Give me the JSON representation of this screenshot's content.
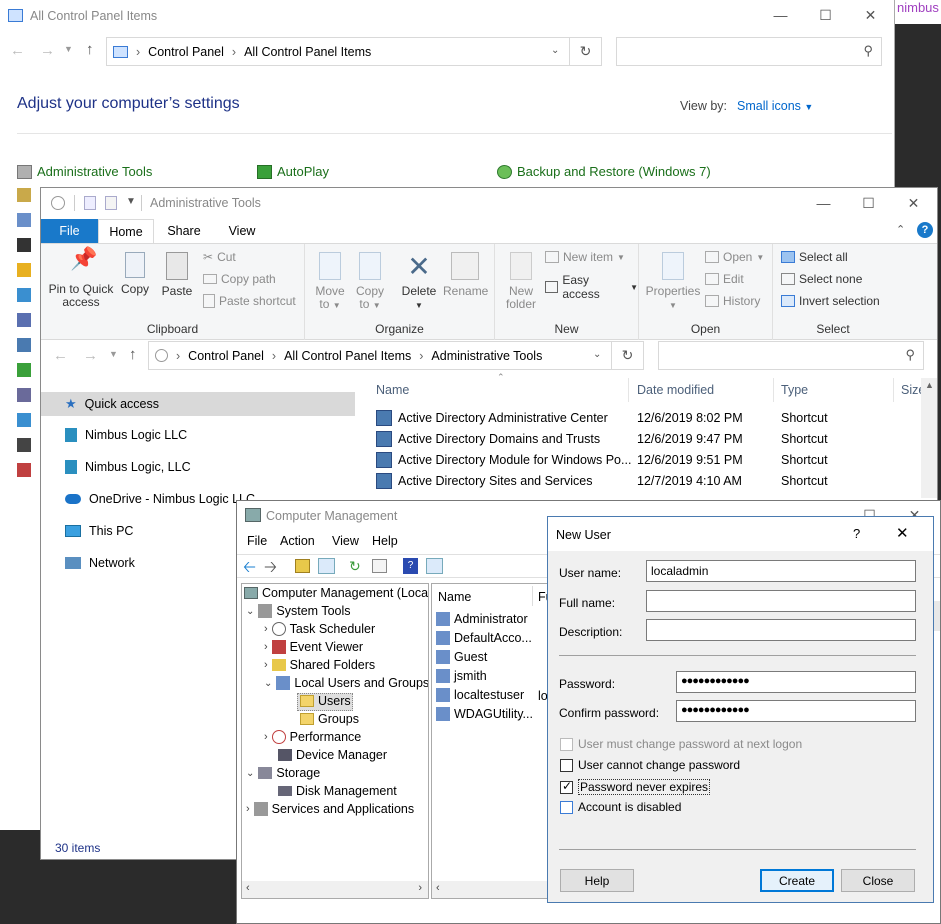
{
  "cp": {
    "title": "All Control Panel Items",
    "breadcrumb": [
      "Control Panel",
      "All Control Panel Items"
    ],
    "heading": "Adjust your computer’s settings",
    "viewby_label": "View by:",
    "viewby_value": "Small icons",
    "items": [
      "Administrative Tools",
      "AutoPlay",
      "Backup and Restore (Windows 7)"
    ],
    "status": "30 items",
    "top_right_text": "nimbus"
  },
  "at": {
    "title": "Administrative Tools",
    "tabs": [
      "File",
      "Home",
      "Share",
      "View"
    ],
    "ribbon": {
      "pin": "Pin to Quick access",
      "copy": "Copy",
      "paste": "Paste",
      "cut": "Cut",
      "copy_path": "Copy path",
      "paste_shortcut": "Paste shortcut",
      "group_clipboard": "Clipboard",
      "move_to": "Move to",
      "copy_to": "Copy to",
      "delete": "Delete",
      "rename": "Rename",
      "group_organize": "Organize",
      "new_folder": "New folder",
      "new_item": "New item",
      "easy_access": "Easy access",
      "group_new": "New",
      "properties": "Properties",
      "open": "Open",
      "edit": "Edit",
      "history": "History",
      "group_open": "Open",
      "select_all": "Select all",
      "select_none": "Select none",
      "invert": "Invert selection",
      "group_select": "Select"
    },
    "breadcrumb": [
      "Control Panel",
      "All Control Panel Items",
      "Administrative Tools"
    ],
    "nav": [
      "Quick access",
      "Nimbus Logic LLC",
      "Nimbus Logic, LLC",
      "OneDrive - Nimbus Logic LLC",
      "This PC",
      "Network"
    ],
    "columns": [
      "Name",
      "Date modified",
      "Type",
      "Size"
    ],
    "files": [
      {
        "name": "Active Directory Administrative Center",
        "date": "12/6/2019 8:02 PM",
        "type": "Shortcut"
      },
      {
        "name": "Active Directory Domains and Trusts",
        "date": "12/6/2019 9:47 PM",
        "type": "Shortcut"
      },
      {
        "name": "Active Directory Module for Windows Po...",
        "date": "12/6/2019 9:51 PM",
        "type": "Shortcut"
      },
      {
        "name": "Active Directory Sites and Services",
        "date": "12/7/2019 4:10 AM",
        "type": "Shortcut"
      }
    ]
  },
  "cm": {
    "title": "Computer Management",
    "menu": [
      "File",
      "Action",
      "View",
      "Help"
    ],
    "tree": [
      "Computer Management (Local",
      "System Tools",
      "Task Scheduler",
      "Event Viewer",
      "Shared Folders",
      "Local Users and Groups",
      "Users",
      "Groups",
      "Performance",
      "Device Manager",
      "Storage",
      "Disk Management",
      "Services and Applications"
    ],
    "col_name": "Name",
    "col_fu": "Fu",
    "users": [
      "Administrator",
      "DefaultAcco...",
      "Guest",
      "jsmith",
      "localtestuser",
      "WDAGUtility..."
    ],
    "lo": "lo"
  },
  "nu": {
    "title": "New User",
    "help_glyph": "?",
    "username_label": "User name:",
    "username_value": "localadmin",
    "fullname_label": "Full name:",
    "description_label": "Description:",
    "password_label": "Password:",
    "password_value": "●●●●●●●●●●●●",
    "confirm_label": "Confirm password:",
    "confirm_value": "●●●●●●●●●●●●",
    "chk_must_change": "User must change password at next logon",
    "chk_cannot_change": "User cannot change password",
    "chk_never_expires": "Password never expires",
    "chk_disabled": "Account is disabled",
    "help_btn": "Help",
    "create_btn": "Create",
    "close_btn": "Close"
  }
}
